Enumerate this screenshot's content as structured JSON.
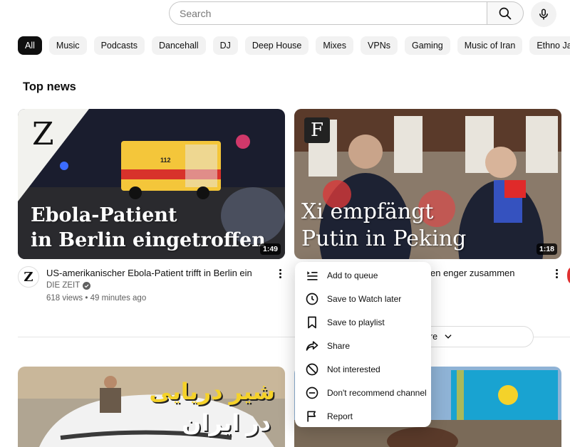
{
  "search": {
    "placeholder": "Search",
    "value": ""
  },
  "chips": [
    "All",
    "Music",
    "Podcasts",
    "Dancehall",
    "DJ",
    "Deep House",
    "Mixes",
    "VPNs",
    "Gaming",
    "Music of Iran",
    "Ethno Jazz"
  ],
  "section": {
    "title": "Top news"
  },
  "videos": [
    {
      "title": "US-amerikanischer Ebola-Patient trifft in Berlin ein",
      "channel": "DIE ZEIT",
      "views": "618 views",
      "age": "49 minutes ago",
      "duration": "1:49",
      "overlay_line1": "Ebola-Patient",
      "overlay_line2": "in Berlin eingetroffen",
      "logo": "Z",
      "ambulance_label": "112"
    },
    {
      "title_partial": "en enger zusammen",
      "duration": "1:18",
      "overlay_line1": "Xi empfängt",
      "overlay_line2": "Putin in Peking",
      "logo": "F"
    },
    {
      "overlay_line1": "شیر دریایی",
      "overlay_line2": "در ایران"
    },
    {}
  ],
  "more_button": {
    "label_partial": "ore"
  },
  "context_menu": [
    {
      "label": "Add to queue",
      "icon": "queue-icon"
    },
    {
      "label": "Save to Watch later",
      "icon": "clock-icon"
    },
    {
      "label": "Save to playlist",
      "icon": "bookmark-icon"
    },
    {
      "label": "Share",
      "icon": "share-icon"
    },
    {
      "label": "Not interested",
      "icon": "block-icon"
    },
    {
      "label": "Don't recommend channel",
      "icon": "minus-circle-icon"
    },
    {
      "label": "Report",
      "icon": "flag-icon"
    }
  ],
  "colors": {
    "accent": "#0f0f0f",
    "chip_bg": "#f2f2f2",
    "meta_text": "#606060"
  }
}
